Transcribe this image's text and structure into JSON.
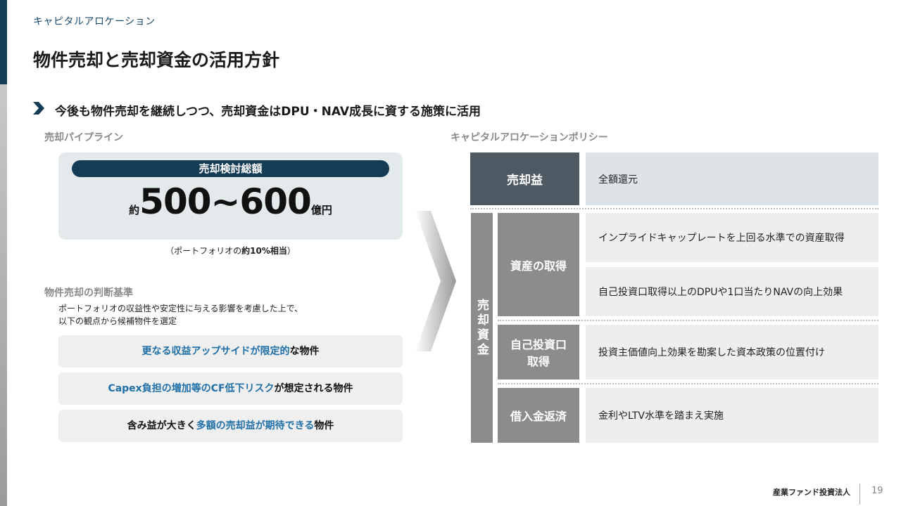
{
  "header": {
    "section": "キャピタルアロケーション",
    "title": "物件売却と売却資金の活用方針"
  },
  "lead": {
    "text": "今後も物件売却を継続しつつ、売却資金はDPU・NAV成長に資する施策に活用"
  },
  "pipeline": {
    "heading": "売却パイプライン",
    "pill_label": "売却検討総額",
    "amount_prefix": "約",
    "amount_value": "500~600",
    "amount_unit": "億円",
    "note_pre": "（ポートフォリオの",
    "note_bold": "約10%相当",
    "note_post": "）"
  },
  "criteria": {
    "heading": "物件売却の判断基準",
    "desc_line1": "ポートフォリオの収益性や安定性に与える影響を考慮した上で、",
    "desc_line2": "以下の観点から候補物件を選定",
    "items": [
      {
        "blue": "更なる収益アップサイドが限定的",
        "rest": "な物件"
      },
      {
        "blue": "Capex負担の増加等のCF低下リスク",
        "rest": "が想定される物件"
      },
      {
        "pre": "含み益が大きく",
        "blue": "多額の売却益が期待できる",
        "rest": "物件"
      }
    ]
  },
  "policy": {
    "heading": "キャピタルアロケーションポリシー",
    "gain_label": "売却益",
    "gain_value": "全額還元",
    "funds_label": "売却資金",
    "asset_label": "資産の取得",
    "asset_item1": "インプライドキャップレートを上回る水準での資産取得",
    "asset_item2": "自己投資口取得以上のDPUや1口当たりNAVの向上効果",
    "buyback_label_1": "自己投資口",
    "buyback_label_2": "取得",
    "buyback_value": "投資主価値向上効果を勘案した資本政策の位置付け",
    "repay_label": "借入金返済",
    "repay_value": "金利やLTV水準を踏まえ実施"
  },
  "footer": {
    "brand": "産業ファンド投資法人",
    "page": "19"
  },
  "colors": {
    "navy": "#143c55",
    "blue_text": "#1f6fa8",
    "dark_cell": "#4d5a63",
    "grey_cell": "#8c8c8c"
  }
}
